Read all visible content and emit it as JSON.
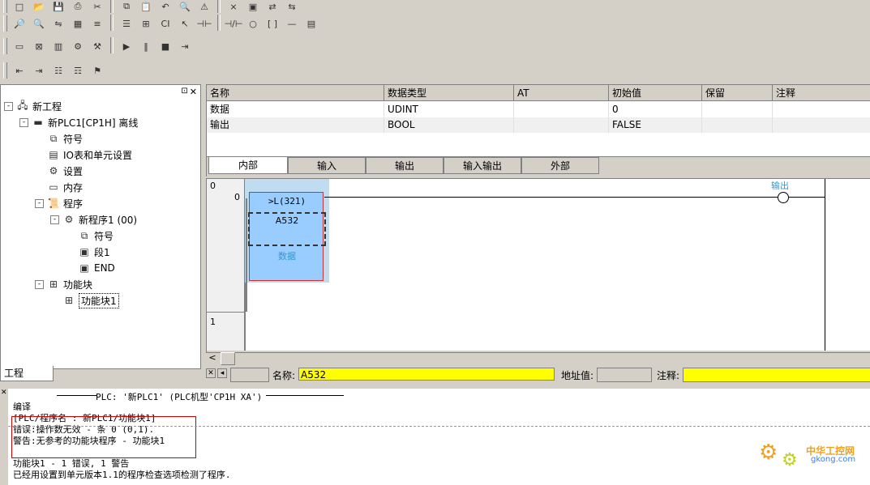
{
  "toolbars": {
    "row1_icons": [
      "new-icon",
      "open-icon",
      "save-icon",
      "print-icon",
      "cut-icon",
      "copy-icon",
      "paste-icon",
      "undo-icon",
      "find-icon",
      "warning-icon",
      "error-icon",
      "monitor-icon",
      "online-icon",
      "transfer-icon"
    ],
    "row2_icons": [
      "zoom-icon",
      "find-icon",
      "replace-icon",
      "grid-icon",
      "symbol-icon",
      "list-icon",
      "io-icon",
      "ci-icon",
      "select-icon",
      "contact-no-icon",
      "contact-nc-icon",
      "coil-icon",
      "instruction-icon",
      "line-icon",
      "function-block-icon"
    ],
    "row3_icons": [
      "layout-icon",
      "cross-ref-icon",
      "memory-icon",
      "settings-icon",
      "compile-icon",
      "run-icon",
      "pause-icon",
      "stop-icon",
      "step-icon"
    ],
    "row4_icons": [
      "indent-icon",
      "outdent-icon",
      "comment-icon",
      "uncomment-icon",
      "bookmark-icon"
    ]
  },
  "tree": {
    "tab_label": "工程",
    "items": [
      {
        "label": "新工程",
        "icon": "project-icon",
        "level": 0,
        "expander": "-"
      },
      {
        "label": "新PLC1[CP1H] 离线",
        "icon": "plc-icon",
        "level": 1,
        "expander": "-"
      },
      {
        "label": "符号",
        "icon": "symbol-icon",
        "level": 2,
        "expander": ""
      },
      {
        "label": "IO表和单元设置",
        "icon": "io-table-icon",
        "level": 2,
        "expander": ""
      },
      {
        "label": "设置",
        "icon": "settings-icon",
        "level": 2,
        "expander": ""
      },
      {
        "label": "内存",
        "icon": "memory-icon",
        "level": 2,
        "expander": ""
      },
      {
        "label": "程序",
        "icon": "program-icon",
        "level": 2,
        "expander": "-"
      },
      {
        "label": "新程序1 (00)",
        "icon": "task-icon",
        "level": 3,
        "expander": "-"
      },
      {
        "label": "符号",
        "icon": "symbol-icon",
        "level": 4,
        "expander": ""
      },
      {
        "label": "段1",
        "icon": "section-icon",
        "level": 4,
        "expander": ""
      },
      {
        "label": "END",
        "icon": "section-icon",
        "level": 4,
        "expander": ""
      },
      {
        "label": "功能块",
        "icon": "function-block-icon",
        "level": 2,
        "expander": "-"
      },
      {
        "label": "功能块1",
        "icon": "function-block-icon",
        "level": 3,
        "expander": "",
        "selected": true
      }
    ]
  },
  "var_table": {
    "headers": [
      "名称",
      "数据类型",
      "AT",
      "初始值",
      "保留",
      "注释"
    ],
    "rows": [
      {
        "name": "数据",
        "type": "UDINT",
        "at": "",
        "init": "0",
        "retain": "",
        "comment": ""
      },
      {
        "name": "输出",
        "type": "BOOL",
        "at": "",
        "init": "FALSE",
        "retain": "",
        "comment": ""
      }
    ],
    "tabs": [
      "内部",
      "输入",
      "输出",
      "输入输出",
      "外部"
    ],
    "active_tab": "内部"
  },
  "ladder": {
    "rung0_num": "0",
    "rung0_step": "0",
    "rung1_num": "1",
    "instruction": ">L(321)",
    "operand1": "A532",
    "operand2": "数据",
    "coil_label": "输出"
  },
  "status": {
    "name_label": "名称:",
    "name_value": "A532",
    "addr_label": "地址值:",
    "addr_value": "",
    "comment_label": "注释:",
    "comment_value": ""
  },
  "output": {
    "header": "PLC: '新PLC1' (PLC机型'CP1H XA')",
    "lines": [
      "编译",
      "[PLC/程序名 : 新PLC1/功能块1]",
      "错误:操作数无效 - 条 0 (0,1).",
      "警告:无参考的功能块程序 - 功能块1",
      "",
      "功能块1 - 1 错误, 1 警告",
      "已经用设置到单元版本1.1的程序检查选项检测了程序."
    ]
  },
  "watermark": {
    "text1": "中华工控网",
    "text2": "gkong.com"
  },
  "colors": {
    "highlight": "#ffff00",
    "block_fill": "#99ccff",
    "selection": "#0a246a",
    "error_box": "#cc0000"
  }
}
